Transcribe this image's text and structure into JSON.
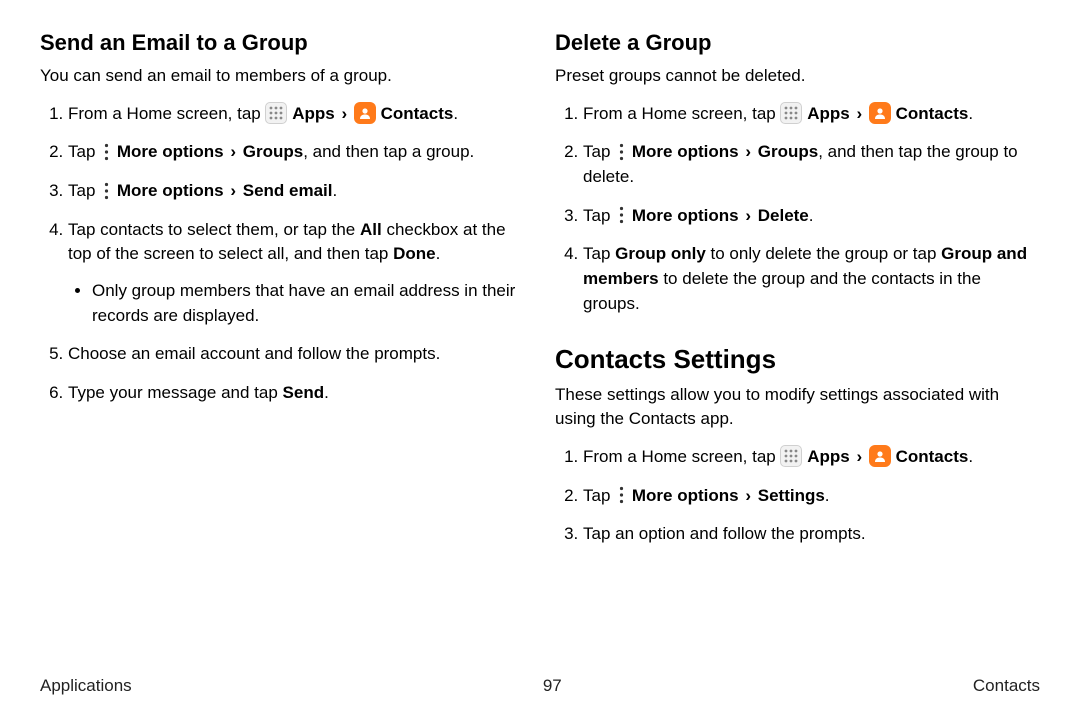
{
  "left": {
    "title": "Send an Email to a Group",
    "intro": "You can send an email to members of a group.",
    "step1_pre": "From a Home screen, tap ",
    "apps": "Apps",
    "contacts": "Contacts",
    "step2_pre": "Tap ",
    "more_options": "More options",
    "groups": "Groups",
    "step2_post": ", and then tap a group.",
    "step3_pre": "Tap ",
    "send_email": "Send email",
    "step4_a": "Tap contacts to select them, or tap the ",
    "all": "All",
    "step4_b": " checkbox at the top of the screen to select all, and then tap ",
    "done": "Done",
    "bullet": "Only group members that have an email address in their records are displayed.",
    "step5": "Choose an email account and follow the prompts.",
    "step6_a": "Type your message and tap ",
    "send": "Send"
  },
  "right": {
    "title1": "Delete a Group",
    "intro1": "Preset groups cannot be deleted.",
    "step1_pre": "From a Home screen, tap ",
    "apps": "Apps",
    "contacts": "Contacts",
    "step2_pre": "Tap ",
    "more_options": "More options",
    "groups": "Groups",
    "step2_post": ", and then tap the group to delete.",
    "step3_pre": "Tap ",
    "delete": "Delete",
    "step4_a": "Tap ",
    "group_only": "Group only",
    "step4_b": " to only delete the group or tap ",
    "group_and_members": "Group and members",
    "step4_c": " to delete the group and the contacts in the groups.",
    "title2": "Contacts Settings",
    "intro2": "These settings allow you to modify settings associated with using the Contacts app.",
    "cs_step1_pre": "From a Home screen, tap ",
    "cs_step2_pre": "Tap ",
    "settings": "Settings",
    "cs_step3": "Tap an option and follow the prompts."
  },
  "footer": {
    "left": "Applications",
    "center": "97",
    "right": "Contacts"
  }
}
